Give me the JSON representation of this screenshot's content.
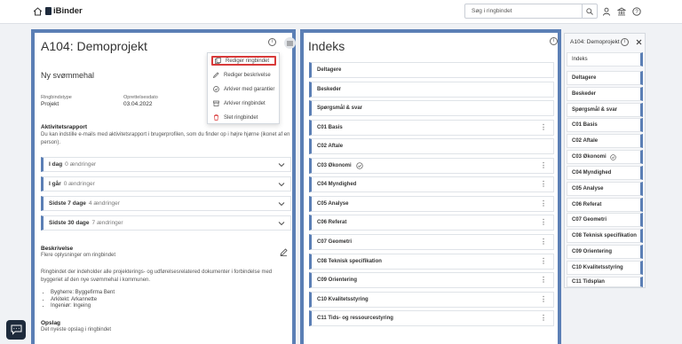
{
  "topbar": {
    "logo_text": "iBinder",
    "search_placeholder": "Søg i ringbindet"
  },
  "left": {
    "title": "A104: Demoprojekt",
    "subtitle": "Ny svømmehal",
    "type_label": "Ringbindstype",
    "type_value": "Projekt",
    "created_label": "Oprettelsesdato",
    "created_value": "03.04.2022",
    "activity_title": "Aktivitetsrapport",
    "activity_text": "Du kan indstille e-mails med aktivitetsrapport i brugerprofilen, som du finder op i højre hjørne (ikonet af en person).",
    "activity": [
      {
        "label": "I dag",
        "count": "0 ændringer"
      },
      {
        "label": "I går",
        "count": "0 ændringer"
      },
      {
        "label": "Sidste 7 dage",
        "count": "4 ændringer"
      },
      {
        "label": "Sidste 30 dage",
        "count": "7 ændringer"
      }
    ],
    "desc_title": "Beskrivelse",
    "desc_sub": "Flere oplysninger om ringbindet",
    "desc_text": "Ringbindet der indeholder alle projekterings- og udførelsesrelatered dokumenter i forbindelse med byggeriet af den nye svømmehal i kommunen.",
    "bullets": [
      "Bygherre: Byggefirma Bent",
      "Arkitekt: Arkannette",
      "Ingeniør: Ingeing"
    ],
    "posts_title": "Opslag",
    "posts_sub": "Det nyeste opslag i ringbindet"
  },
  "dropdown": {
    "items": [
      "Rediger ringbindet",
      "Rediger beskrivelse",
      "Arkiver med garantier",
      "Arkiver ringbindet",
      "Slet ringbindet"
    ]
  },
  "middle": {
    "title": "Indeks",
    "rows": [
      "Deltagere",
      "Beskeder",
      "Spørgsmål & svar",
      "C01 Basis",
      "C02 Aftale",
      "C03 Økonomi",
      "C04 Myndighed",
      "C05 Analyse",
      "C06 Referat",
      "C07 Geometri",
      "C08 Teknisk specifikation",
      "C09 Orientering",
      "C10 Kvalitetsstyring",
      "C11 Tids- og ressourcestyring"
    ]
  },
  "right": {
    "title": "A104: Demoprojekt",
    "items": [
      "Indeks",
      "Deltagere",
      "Beskeder",
      "Spørgsmål & svar",
      "C01 Basis",
      "C02 Aftale",
      "C03 Økonomi",
      "C04 Myndighed",
      "C05 Analyse",
      "C06 Referat",
      "C07 Geometri",
      "C08 Teknisk specifikation",
      "C09 Orientering",
      "C10 Kvalitetsstyring",
      "C11 Tidsplan"
    ]
  },
  "colors": {
    "accent": "#5b7fb5",
    "highlight": "#d83a3a",
    "dark": "#1e2b3c"
  }
}
